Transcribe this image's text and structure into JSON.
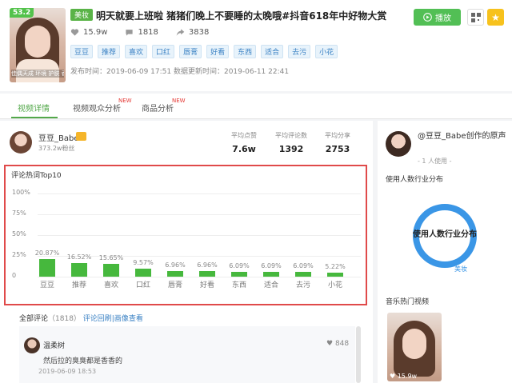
{
  "video": {
    "score": "53.2",
    "category": "美妆",
    "title": "明天就要上班啦 猪猪们晚上不要睡的太晚哦#抖音618年中好物大赏",
    "thumb_caption": "佳偶天成 环境 护肤 香港",
    "likes": "15.9w",
    "comments": "1818",
    "shares": "3838",
    "tags": [
      "豆豆",
      "推荐",
      "喜欢",
      "口红",
      "唇膏",
      "好看",
      "东西",
      "适合",
      "去污",
      "小花"
    ],
    "times": "发布时间：2019-06-09 17:51 数据更新时间：2019-06-11 22:41",
    "play_label": "播放"
  },
  "tabs": [
    {
      "label": "视频详情",
      "new": ""
    },
    {
      "label": "视频观众分析",
      "new": "NEW"
    },
    {
      "label": "商品分析",
      "new": "NEW"
    }
  ],
  "author": {
    "name": "豆豆_Babe",
    "fans": "373.2w粉丝",
    "metrics": [
      {
        "label": "平均点赞",
        "value": "7.6w"
      },
      {
        "label": "平均评论数",
        "value": "1392"
      },
      {
        "label": "平均分享",
        "value": "2753"
      }
    ]
  },
  "chart_data": {
    "type": "bar",
    "title": "评论热词Top10",
    "categories": [
      "豆豆",
      "推荐",
      "喜欢",
      "口红",
      "唇膏",
      "好看",
      "东西",
      "适合",
      "去污",
      "小花"
    ],
    "values": [
      20.87,
      16.52,
      15.65,
      9.57,
      6.96,
      6.96,
      6.09,
      6.09,
      6.09,
      5.22
    ],
    "value_labels": [
      "20.87%",
      "16.52%",
      "15.65%",
      "9.57%",
      "6.96%",
      "6.96%",
      "6.09%",
      "6.09%",
      "6.09%",
      "5.22%"
    ],
    "yticks": [
      "100%",
      "75%",
      "50%",
      "25%",
      "0"
    ],
    "ylim": [
      0,
      100
    ],
    "color": "#46b83d",
    "grid": true
  },
  "comments": {
    "header_label": "全部评论",
    "count": "（1818）",
    "link": "评论回刷|画像查看",
    "items": [
      {
        "user": "温柔树",
        "likes": "848",
        "text": "然后拉的臭臭都是香香的",
        "date": "2019-06-09 18:53"
      }
    ]
  },
  "side": {
    "title": "@豆豆_Babe创作的原声",
    "title_tail": "创作的原声",
    "users": "- 1 人使用 -",
    "industry_label": "使用人数行业分布",
    "donut_text": "使用人数行业分布",
    "donut_legend": "美妆",
    "music_label": "音乐热门视频",
    "hot_likes": "15.9w"
  },
  "colors": {
    "accent": "#53a84a",
    "highlight": "#e04a4a",
    "donut": "#3a96e6"
  }
}
